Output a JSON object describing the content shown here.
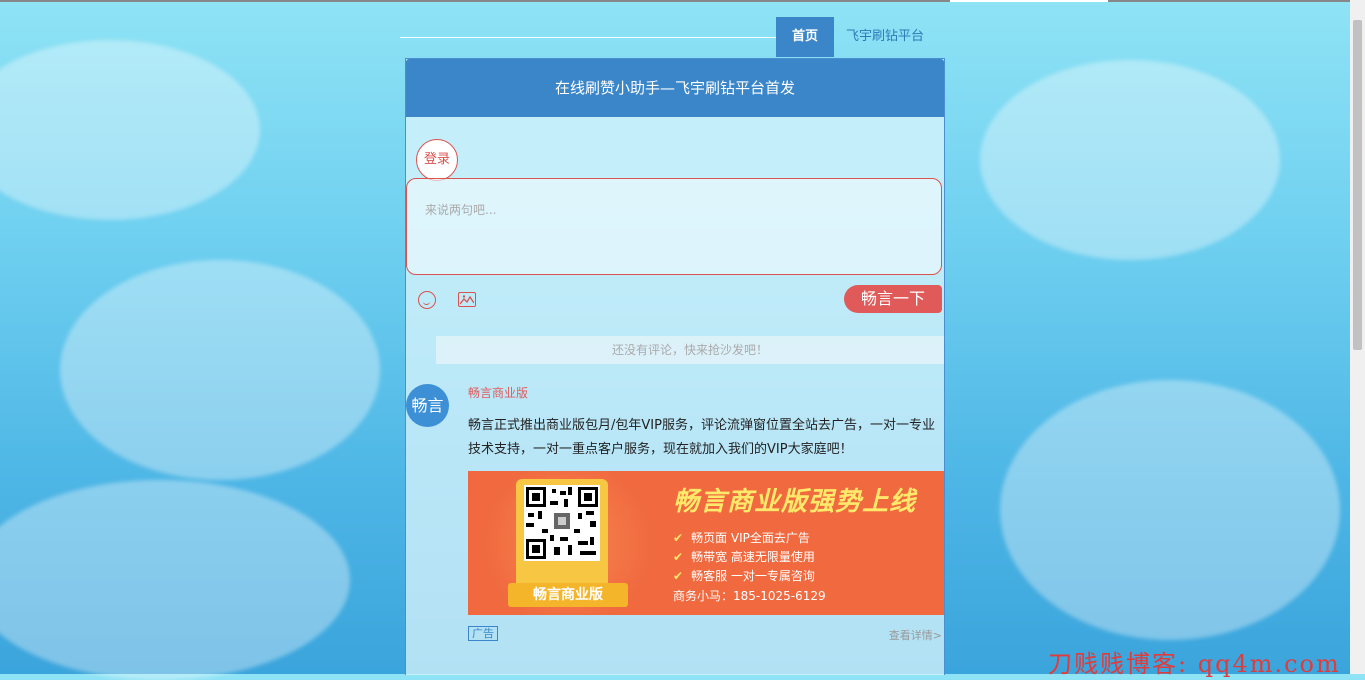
{
  "nav": {
    "home": "首页",
    "platform": "飞宇刷钻平台"
  },
  "panel": {
    "title": "在线刷赞小助手—飞宇刷钻平台首发",
    "login": "登录",
    "comment_placeholder": "来说两句吧...",
    "send_button": "畅言一下",
    "no_comment": "还没有评论，快来抢沙发吧！"
  },
  "ad": {
    "avatar_text": "畅言",
    "title": "畅言商业版",
    "text": "畅言正式推出商业版包月/包年VIP服务，评论流弹窗位置全站去广告，一对一专业技术支持，一对一重点客户服务，现在就加入我们的VIP大家庭吧！",
    "banner": {
      "title": "畅言商业版强势上线",
      "qr_label": "畅言商业版",
      "features": [
        "畅页面   VIP全面去广告",
        "畅带宽   高速无限量使用",
        "畅客服   一对一专属咨询"
      ],
      "contact": "商务小马：185-1025-6129"
    },
    "tag": "广告",
    "more": "查看详情>"
  },
  "watermark": "刀贱贱博客: qq4m.com",
  "colors": {
    "nav_blue": "#3b86c8",
    "accent_red": "#e05a5a",
    "banner_orange": "#f0693f",
    "banner_yellow": "#ffe96a"
  }
}
